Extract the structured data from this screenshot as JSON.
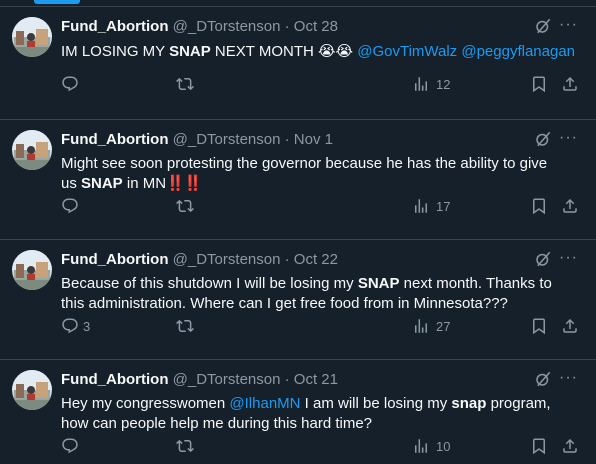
{
  "tweets": [
    {
      "name": "Fund_Abortion",
      "handle": "@_DTorstenson",
      "date": "Oct 28",
      "text_parts": [
        "IM LOSING MY ",
        "SNAP",
        " NEXT MONTH ",
        "😭😭",
        " ",
        "@GovTimWalz",
        " ",
        "@peggyflanagan"
      ],
      "replies": "",
      "views": "12"
    },
    {
      "name": "Fund_Abortion",
      "handle": "@_DTorstenson",
      "date": "Nov 1",
      "line1": "Might see soon protesting the governor because he has the ability to give",
      "line2_a": "us ",
      "line2_b": "SNAP",
      "line2_c": " in MN",
      "bangs": "‼️‼️",
      "replies": "",
      "views": "17"
    },
    {
      "name": "Fund_Abortion",
      "handle": "@_DTorstenson",
      "date": "Oct 22",
      "line1_a": "Because of this shutdown I will be losing my ",
      "line1_b": "SNAP",
      "line1_c": " next month. Thanks to",
      "line2": "this administration. Where can I get free food from in Minnesota???",
      "replies": "3",
      "views": "27"
    },
    {
      "name": "Fund_Abortion",
      "handle": "@_DTorstenson",
      "date": "Oct 21",
      "line1_a": "Hey my congresswomen ",
      "line1_b": "@IlhanMN",
      "line1_c": " I am will be losing my ",
      "line1_d": "snap",
      "line1_e": " program,",
      "line2": "how can people help me during this hard time?",
      "replies": "",
      "views": "10"
    }
  ],
  "separator": " · ",
  "more_label": "···",
  "icons": [
    "reply-icon",
    "retweet-icon",
    "views-icon",
    "bookmark-icon",
    "share-icon",
    "grok-icon",
    "more-icon"
  ]
}
